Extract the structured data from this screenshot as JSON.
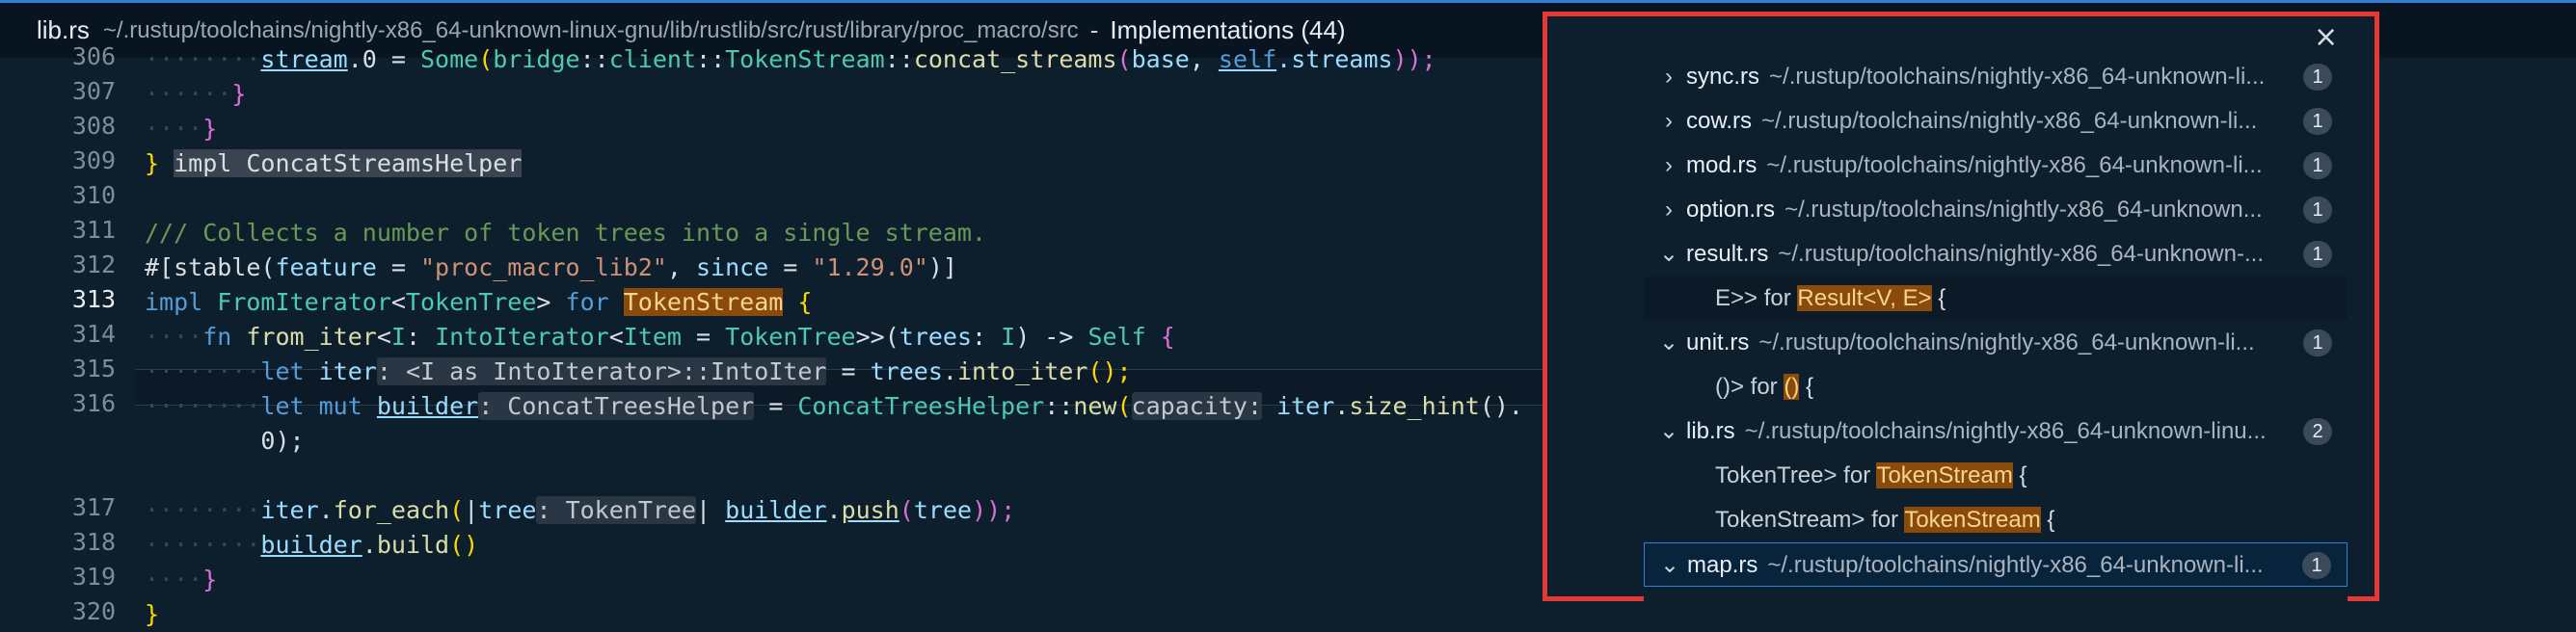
{
  "title": {
    "file": "lib.rs",
    "path": "~/.rustup/toolchains/nightly-x86_64-unknown-linux-gnu/lib/rustlib/src/rust/library/proc_macro/src",
    "separator": "-",
    "peek_label": "Implementations (44)"
  },
  "editor": {
    "line_numbers": [
      "306",
      "307",
      "308",
      "309",
      "310",
      "311",
      "312",
      "313",
      "314",
      "315",
      "316",
      "",
      "317",
      "318",
      "319",
      "320"
    ],
    "active_line": "313"
  },
  "code": {
    "l306_a": "stream",
    "l306_b": ".0 = ",
    "l306_c": "Some",
    "l306_d": "(",
    "l306_e": "bridge",
    "l306_f": "::",
    "l306_g": "client",
    "l306_h": "::",
    "l306_i": "TokenStream",
    "l306_j": "::",
    "l306_k": "concat_streams",
    "l306_l": "(",
    "l306_m": "base",
    "l306_n": ", ",
    "l306_o": "self",
    "l306_p": ".streams",
    "l306_q": "));",
    "l307": "}",
    "l308": "}",
    "l309_a": "} ",
    "l309_b": "impl ConcatStreamsHelper",
    "l311": "/// Collects a number of token trees into a single stream.",
    "l312_a": "#[stable(",
    "l312_b": "feature",
    "l312_c": " = ",
    "l312_d": "\"proc_macro_lib2\"",
    "l312_e": ", ",
    "l312_f": "since",
    "l312_g": " = ",
    "l312_h": "\"1.29.0\"",
    "l312_i": ")]",
    "l313_a": "impl ",
    "l313_b": "FromIterator",
    "l313_c": "<",
    "l313_d": "TokenTree",
    "l313_e": "> ",
    "l313_f": "for ",
    "l313_g": "TokenStream",
    "l313_h": " {",
    "l314_a": "fn ",
    "l314_b": "from_iter",
    "l314_c": "<",
    "l314_d": "I",
    "l314_e": ": ",
    "l314_f": "IntoIterator",
    "l314_g": "<",
    "l314_h": "Item",
    "l314_i": " = ",
    "l314_j": "TokenTree",
    "l314_k": ">>(",
    "l314_l": "trees",
    "l314_m": ": ",
    "l314_n": "I",
    "l314_o": ") -> ",
    "l314_p": "Self",
    "l314_q": " {",
    "l315_a": "let ",
    "l315_b": "iter",
    "l315_c": ": <I as IntoIterator>::IntoIter",
    "l315_d": " = ",
    "l315_e": "trees",
    "l315_f": ".",
    "l315_g": "into_iter",
    "l315_h": "();",
    "l316_a": "let mut ",
    "l316_b": "builder",
    "l316_c": ": ConcatTreesHelper",
    "l316_d": " = ",
    "l316_e": "ConcatTreesHelper",
    "l316_f": "::",
    "l316_g": "new",
    "l316_h": "(",
    "l316_i": "capacity:",
    "l316_j": " iter",
    "l316_k": ".",
    "l316_l": "size_hint",
    "l316_m": "().",
    "l316w": "0);",
    "l317_a": "iter",
    "l317_b": ".",
    "l317_c": "for_each",
    "l317_d": "(",
    "l317_e": "|",
    "l317_f": "tree",
    "l317_g": ": TokenTree",
    "l317_h": "| ",
    "l317_i": "builder",
    "l317_j": ".",
    "l317_k": "push",
    "l317_l": "(",
    "l317_m": "tree",
    "l317_n": "));",
    "l318_a": "builder",
    "l318_b": ".",
    "l318_c": "build",
    "l318_d": "()",
    "l319": "}",
    "l320": "}"
  },
  "peek": {
    "close": "×",
    "rows": [
      {
        "name": "sync.rs",
        "path": "~/.rustup/toolchains/nightly-x86_64-unknown-li...",
        "count": "1"
      },
      {
        "name": "cow.rs",
        "path": "~/.rustup/toolchains/nightly-x86_64-unknown-li...",
        "count": "1"
      },
      {
        "name": "mod.rs",
        "path": "~/.rustup/toolchains/nightly-x86_64-unknown-li...",
        "count": "1"
      },
      {
        "name": "option.rs",
        "path": "~/.rustup/toolchains/nightly-x86_64-unknown...",
        "count": "1"
      },
      {
        "name": "result.rs",
        "path": "~/.rustup/toolchains/nightly-x86_64-unknown-...",
        "count": "1"
      },
      {
        "name": "unit.rs",
        "path": "~/.rustup/toolchains/nightly-x86_64-unknown-li...",
        "count": "1"
      },
      {
        "name": "lib.rs",
        "path": "~/.rustup/toolchains/nightly-x86_64-unknown-linu...",
        "count": "2"
      },
      {
        "name": "map.rs",
        "path": "~/.rustup/toolchains/nightly-x86_64-unknown-li...",
        "count": "1"
      }
    ],
    "child_result": {
      "pre": "E>> for ",
      "hl": "Result<V, E>",
      "post": " {"
    },
    "child_unit": {
      "pre": "()> for ",
      "hl": "()",
      "post": " {"
    },
    "child_lib1": {
      "pre": "TokenTree> for ",
      "hl": "TokenStream",
      "post": " {"
    },
    "child_lib2": {
      "pre": "TokenStream> for ",
      "hl": "TokenStream",
      "post": " {"
    }
  },
  "colors": {
    "accent": "#2f7fd6",
    "highlight_box": "#e53935",
    "background": "#0d1f2d"
  },
  "icons": {
    "expanded": "chevron-down-icon",
    "collapsed": "chevron-right-icon",
    "close": "close-icon"
  }
}
